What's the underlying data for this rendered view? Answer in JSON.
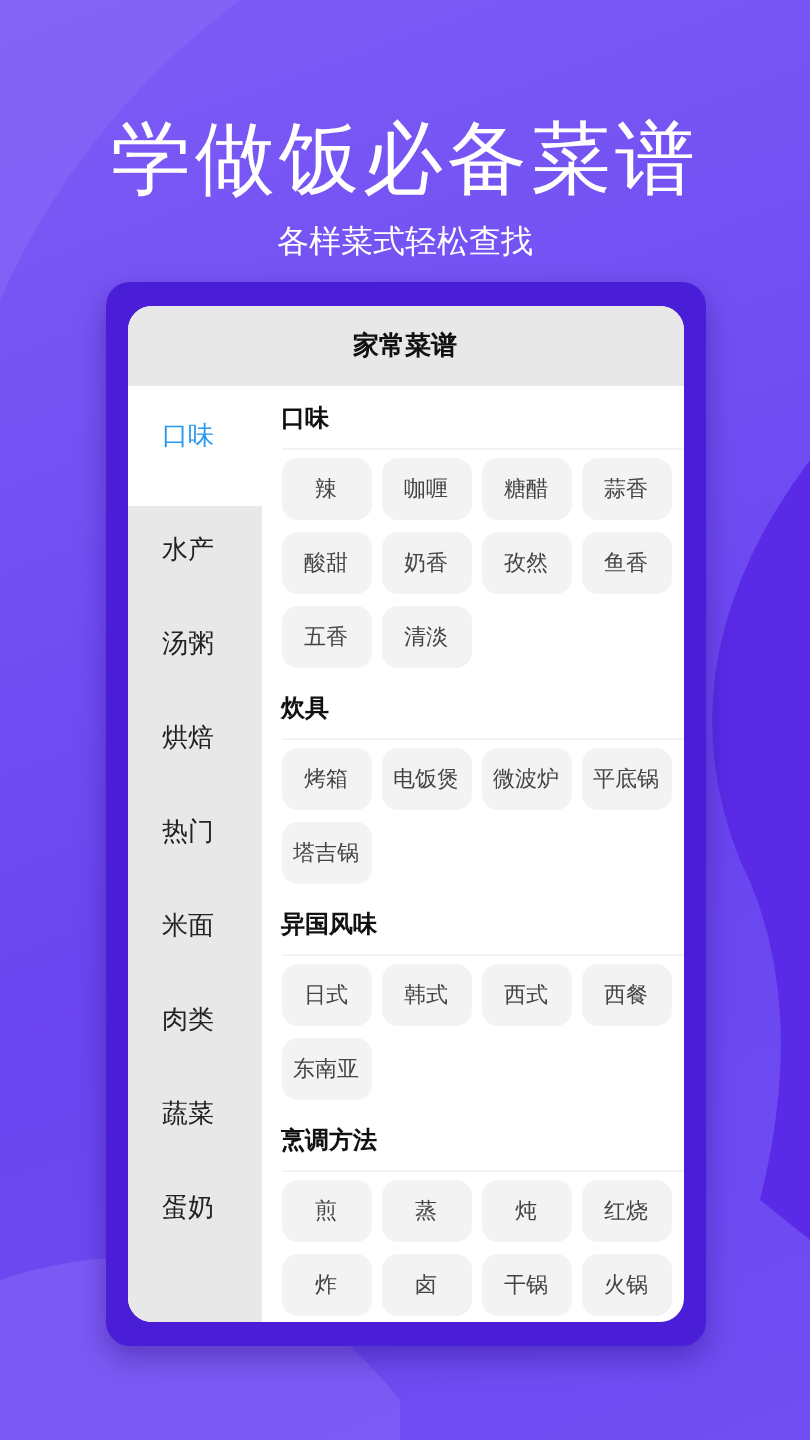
{
  "headline": "学做饭必备菜谱",
  "subheadline": "各样菜式轻松查找",
  "screen": {
    "title": "家常菜谱",
    "sidebar": {
      "items": [
        {
          "label": "口味",
          "selected": true
        },
        {
          "label": "水产",
          "selected": false
        },
        {
          "label": "汤粥",
          "selected": false
        },
        {
          "label": "烘焙",
          "selected": false
        },
        {
          "label": "热门",
          "selected": false
        },
        {
          "label": "米面",
          "selected": false
        },
        {
          "label": "肉类",
          "selected": false
        },
        {
          "label": "蔬菜",
          "selected": false
        },
        {
          "label": "蛋奶",
          "selected": false
        }
      ]
    },
    "sections": [
      {
        "title": "口味",
        "tags": [
          "辣",
          "咖喱",
          "糖醋",
          "蒜香",
          "酸甜",
          "奶香",
          "孜然",
          "鱼香",
          "五香",
          "清淡"
        ]
      },
      {
        "title": "炊具",
        "tags": [
          "烤箱",
          "电饭煲",
          "微波炉",
          "平底锅",
          "塔吉锅"
        ]
      },
      {
        "title": "异国风味",
        "tags": [
          "日式",
          "韩式",
          "西式",
          "西餐",
          "东南亚"
        ]
      },
      {
        "title": "烹调方法",
        "tags": [
          "煎",
          "蒸",
          "炖",
          "红烧",
          "炸",
          "卤",
          "干锅",
          "火锅"
        ]
      }
    ]
  }
}
